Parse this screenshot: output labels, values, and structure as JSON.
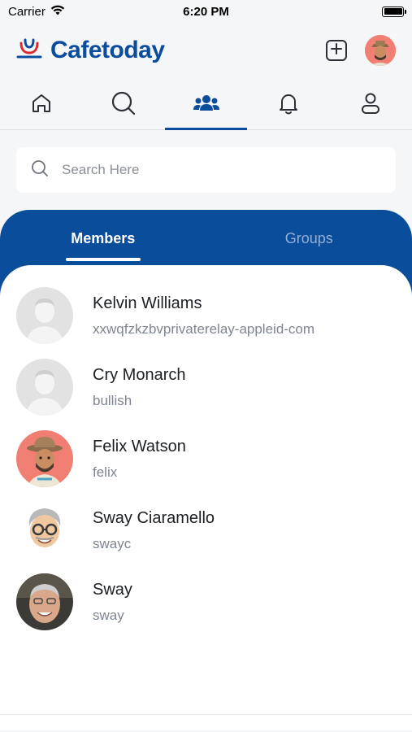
{
  "status_bar": {
    "carrier": "Carrier",
    "time": "6:20 PM",
    "battery_level": 1.0
  },
  "header": {
    "app_name": "Cafetoday",
    "add_icon": "plus-square-icon",
    "profile_avatar": "avatar-icon"
  },
  "nav": {
    "items": [
      {
        "icon": "home-icon",
        "active": false
      },
      {
        "icon": "search-icon",
        "active": false
      },
      {
        "icon": "people-icon",
        "active": true
      },
      {
        "icon": "bell-icon",
        "active": false
      },
      {
        "icon": "person-icon",
        "active": false
      }
    ]
  },
  "search": {
    "placeholder": "Search Here",
    "value": ""
  },
  "segments": {
    "members_label": "Members",
    "groups_label": "Groups",
    "active": "Members"
  },
  "members": [
    {
      "name": "Kelvin Williams",
      "handle": "xxwqfzkzbvprivaterelay-appleid-com",
      "avatar": "default-avatar"
    },
    {
      "name": "Cry Monarch",
      "handle": "bullish",
      "avatar": "default-avatar"
    },
    {
      "name": "Felix Watson",
      "handle": "felix",
      "avatar": "cartoon-hat-avatar"
    },
    {
      "name": "Sway Ciaramello",
      "handle": "swayc",
      "avatar": "memoji-glasses-avatar"
    },
    {
      "name": "Sway",
      "handle": "sway",
      "avatar": "photo-avatar"
    }
  ],
  "colors": {
    "brand_blue": "#0b4d9c",
    "panel_blue": "#0a4d9a",
    "logo_red": "#d62c2c",
    "background": "#f5f6f8"
  }
}
